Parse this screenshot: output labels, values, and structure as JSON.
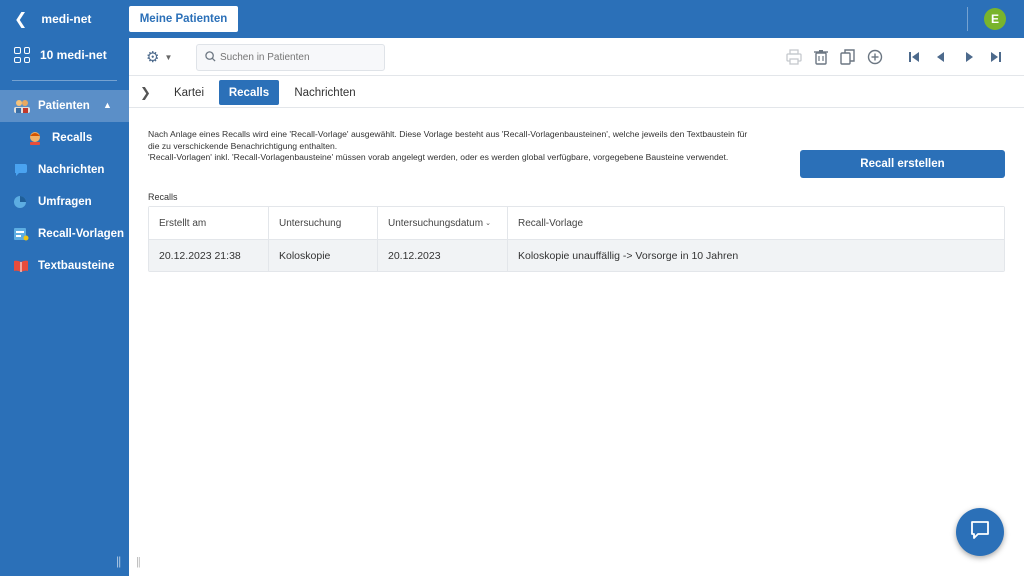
{
  "sidebar": {
    "app_title": "medi-net",
    "app_item": "10 medi-net",
    "items": [
      {
        "label": "Patienten"
      },
      {
        "label": "Recalls"
      },
      {
        "label": "Nachrichten"
      },
      {
        "label": "Umfragen"
      },
      {
        "label": "Recall-Vorlagen"
      },
      {
        "label": "Textbausteine"
      }
    ]
  },
  "header": {
    "tab_label": "Meine Patienten",
    "avatar_initial": "E"
  },
  "toolbar": {
    "search_placeholder": "Suchen in Patienten"
  },
  "tabs": [
    {
      "label": "Kartei"
    },
    {
      "label": "Recalls"
    },
    {
      "label": "Nachrichten"
    }
  ],
  "content": {
    "info_line1": "Nach Anlage eines Recalls wird eine 'Recall-Vorlage' ausgewählt. Diese Vorlage besteht aus 'Recall-Vorlagenbausteinen', welche jeweils den Textbaustein für die zu verschickende Benachrichtigung enthalten.",
    "info_line2": "'Recall-Vorlagen' inkl. 'Recall-Vorlagenbausteine' müssen vorab angelegt werden, oder es werden global verfügbare, vorgegebene Bausteine verwendet.",
    "create_button": "Recall erstellen",
    "section_label": "Recalls"
  },
  "table": {
    "headers": [
      "Erstellt am",
      "Untersuchung",
      "Untersuchungsdatum",
      "Recall-Vorlage"
    ],
    "rows": [
      [
        "20.12.2023 21:38",
        "Koloskopie",
        "20.12.2023",
        "Koloskopie unauffällig -> Vorsorge in 10 Jahren"
      ]
    ]
  },
  "colors": {
    "primary": "#2b70b8",
    "sidebar_active": "#5b8fc8",
    "avatar": "#79b42c"
  }
}
